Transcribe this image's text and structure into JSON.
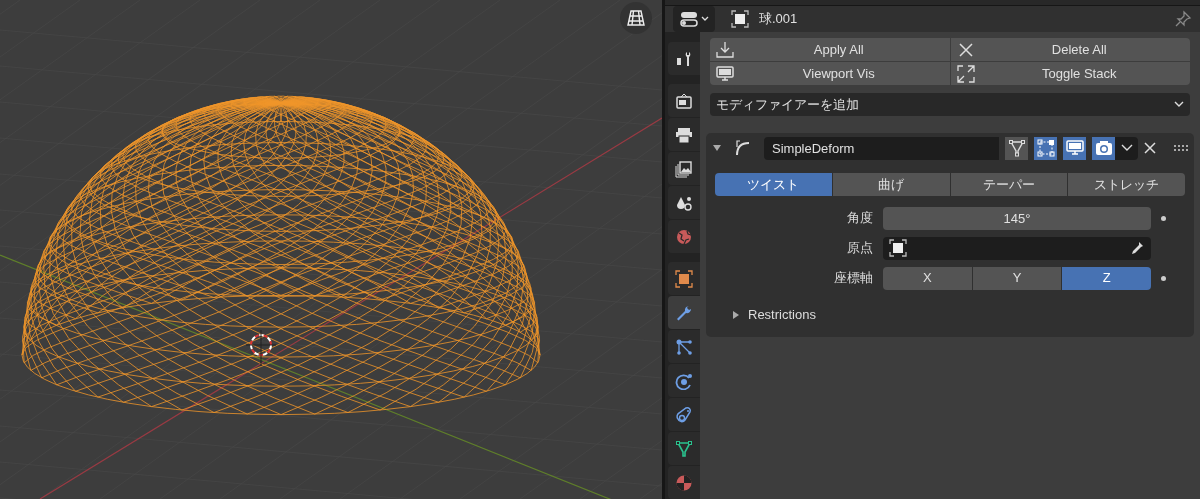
{
  "header": {
    "object_name": "球.001"
  },
  "property_tabs": [
    {
      "selected": false
    },
    {
      "selected": false
    },
    {
      "selected": false
    },
    {
      "selected": false
    },
    {
      "selected": false
    },
    {
      "selected": false
    },
    {
      "selected": false
    },
    {
      "selected": true
    },
    {
      "selected": false
    },
    {
      "selected": false
    },
    {
      "selected": false
    },
    {
      "selected": false
    },
    {
      "selected": false
    }
  ],
  "toolbar": [
    {
      "label": "Apply All"
    },
    {
      "label": "Delete All"
    },
    {
      "label": "Viewport Vis"
    },
    {
      "label": "Toggle Stack"
    }
  ],
  "add_modifier": {
    "label": "モディファイアーを追加"
  },
  "modifier": {
    "name": "SimpleDeform",
    "expanded": true,
    "toggles": [
      {
        "on": false
      },
      {
        "on": true
      },
      {
        "on": true
      },
      {
        "on": true
      }
    ],
    "modes": [
      {
        "label": "ツイスト",
        "selected": true
      },
      {
        "label": "曲げ",
        "selected": false
      },
      {
        "label": "テーパー",
        "selected": false
      },
      {
        "label": "ストレッチ",
        "selected": false
      }
    ],
    "angle": {
      "label": "角度",
      "value": "145°"
    },
    "origin": {
      "label": "原点"
    },
    "axis": {
      "label": "座標軸",
      "options": [
        {
          "label": "X",
          "selected": false
        },
        {
          "label": "Y",
          "selected": false
        },
        {
          "label": "Z",
          "selected": true
        }
      ]
    },
    "restrictions": {
      "label": "Restrictions",
      "expanded": false
    }
  }
}
